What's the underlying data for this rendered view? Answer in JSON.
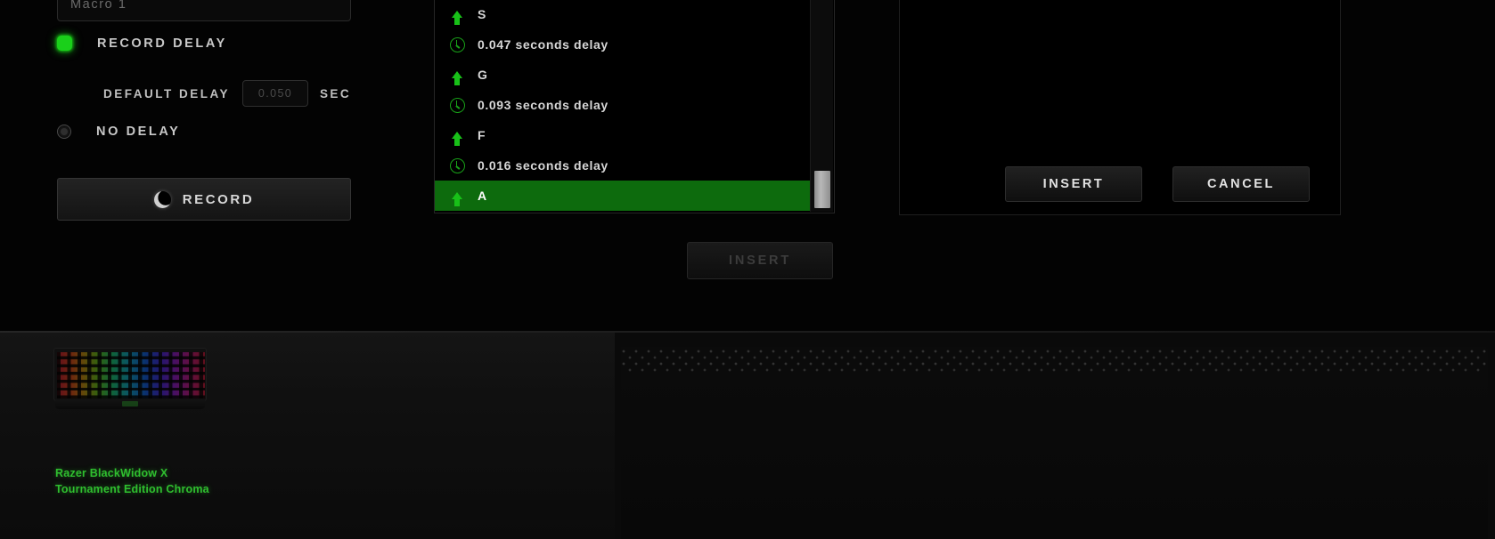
{
  "macro_settings": {
    "name_field": {
      "value": "Macro 1",
      "placeholder": "Macro 1"
    },
    "delay_mode": {
      "record_delay_label": "RECORD DELAY",
      "record_delay_selected": true,
      "no_delay_label": "NO DELAY",
      "no_delay_selected": false
    },
    "default_delay": {
      "label": "DEFAULT DELAY",
      "value": "0.050",
      "unit": "SEC"
    },
    "record_button_label": "RECORD"
  },
  "sequence": {
    "rows": [
      {
        "icon": "arrow-up-icon",
        "text": "S",
        "selected": false
      },
      {
        "icon": "clock-icon",
        "text": "0.047 seconds delay",
        "selected": false
      },
      {
        "icon": "arrow-up-icon",
        "text": "G",
        "selected": false
      },
      {
        "icon": "clock-icon",
        "text": "0.093 seconds delay",
        "selected": false
      },
      {
        "icon": "arrow-up-icon",
        "text": "F",
        "selected": false
      },
      {
        "icon": "clock-icon",
        "text": "0.016 seconds delay",
        "selected": false
      },
      {
        "icon": "arrow-up-icon",
        "text": "A",
        "selected": true
      }
    ],
    "insert_button_label": "INSERT"
  },
  "command_panel": {
    "insert_button_label": "INSERT",
    "cancel_button_label": "CANCEL"
  },
  "device": {
    "name_line1": "Razer BlackWidow X",
    "name_line2": "Tournament Edition Chroma"
  },
  "colors": {
    "accent_green": "#1ad01a",
    "selection_green": "#0d6b0d",
    "device_name_green": "#2fbf2f",
    "background": "#000000",
    "panel_border": "#262626"
  }
}
